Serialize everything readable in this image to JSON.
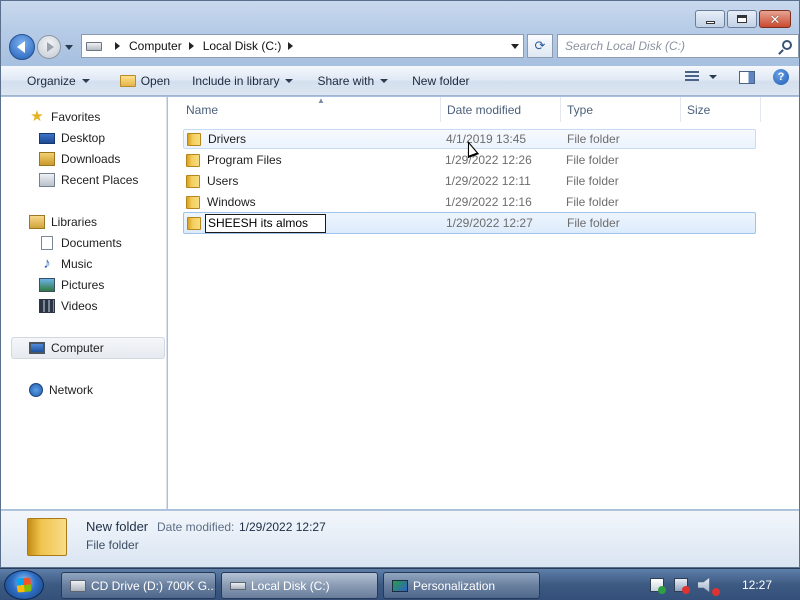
{
  "window": {
    "controls": {
      "minimize": "minimize",
      "maximize": "maximize",
      "close": "✕"
    }
  },
  "address_bar": {
    "crumbs": [
      "Computer",
      "Local Disk (C:)"
    ],
    "search_placeholder": "Search Local Disk (C:)",
    "refresh_glyph": "⟳"
  },
  "toolbar": {
    "organize": "Organize",
    "open": "Open",
    "include_in_library": "Include in library",
    "share_with": "Share with",
    "new_folder": "New folder",
    "help": "?"
  },
  "nav_pane": {
    "favorites": "Favorites",
    "desktop": "Desktop",
    "downloads": "Downloads",
    "recent_places": "Recent Places",
    "libraries": "Libraries",
    "documents": "Documents",
    "music": "Music",
    "pictures": "Pictures",
    "videos": "Videos",
    "computer": "Computer",
    "network": "Network"
  },
  "columns": {
    "name": "Name",
    "date_modified": "Date modified",
    "type": "Type",
    "size": "Size"
  },
  "files": [
    {
      "name": "Drivers",
      "date": "4/1/2019 13:45",
      "type": "File folder"
    },
    {
      "name": "Program Files",
      "date": "1/29/2022 12:26",
      "type": "File folder"
    },
    {
      "name": "Users",
      "date": "1/29/2022 12:11",
      "type": "File folder"
    },
    {
      "name": "Windows",
      "date": "1/29/2022 12:16",
      "type": "File folder"
    },
    {
      "name": "SHEESH its almos",
      "date": "1/29/2022 12:27",
      "type": "File folder"
    }
  ],
  "details": {
    "name": "New folder",
    "modified_label": "Date modified:",
    "modified_value": "1/29/2022 12:27",
    "type": "File folder"
  },
  "taskbar": {
    "tasks": [
      "CD Drive (D:) 700K G...",
      "Local Disk (C:)",
      "Personalization"
    ],
    "clock": "12:27"
  }
}
